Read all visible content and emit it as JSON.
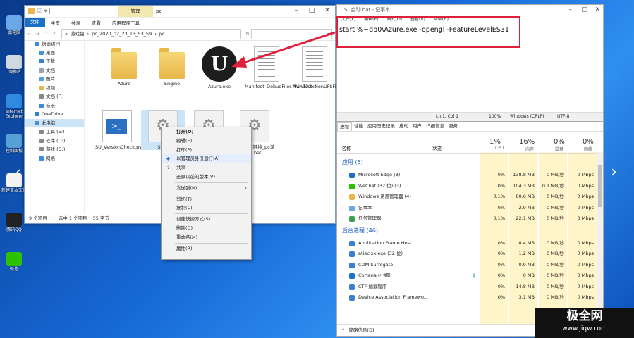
{
  "desktop": {
    "icons": [
      {
        "label": "此电脑",
        "icon": "computer-icon",
        "color": "#6aa8e8"
      },
      {
        "label": "回收站",
        "icon": "recycle-bin-icon",
        "color": "#d0d8e0"
      },
      {
        "label": "Internet Explorer",
        "icon": "ie-icon",
        "color": "#2f8ae0"
      },
      {
        "label": "控制面板",
        "icon": "control-panel-icon",
        "color": "#58a0d8"
      },
      {
        "label": "新建文本文档",
        "icon": "text-file-icon",
        "color": "#f4f4f4"
      },
      {
        "label": "腾讯QQ",
        "icon": "qq-icon",
        "color": "#222222"
      },
      {
        "label": "微信",
        "icon": "wechat-icon",
        "color": "#2dc100"
      }
    ]
  },
  "explorer": {
    "tab_manage": "管理",
    "title": "pc",
    "ribbon_tabs": [
      "文件",
      "主页",
      "共享",
      "查看",
      "应用程序工具"
    ],
    "address": {
      "parts": [
        "«",
        "游戏包",
        "›",
        "pc_2020_02_23_13_53_59",
        "›",
        "pc"
      ],
      "search_icon": "search-icon"
    },
    "nav_items": [
      {
        "label": "快速访问",
        "icon": "star-icon",
        "color": "#3b8de0"
      },
      {
        "label": "桌面",
        "icon": "desktop-icon",
        "color": "#4a90d9"
      },
      {
        "label": "下载",
        "icon": "download-icon",
        "color": "#3b7fd0"
      },
      {
        "label": "文档",
        "icon": "documents-icon",
        "color": "#9aa4b0"
      },
      {
        "label": "图片",
        "icon": "pictures-icon",
        "color": "#5aa0d8"
      },
      {
        "label": "视频",
        "icon": "folder-icon",
        "color": "#e8b64a"
      },
      {
        "label": "文档 (F:)",
        "icon": "drive-icon",
        "color": "#888888"
      },
      {
        "label": "音乐",
        "icon": "music-icon",
        "color": "#3b8de0"
      },
      {
        "label": "OneDrive",
        "icon": "onedrive-icon",
        "color": "#2f7fd0"
      },
      {
        "label": "此电脑",
        "icon": "computer-icon",
        "color": "#4a90d9"
      },
      {
        "label": "工具 (E:)",
        "icon": "drive-icon",
        "color": "#888888"
      },
      {
        "label": "软件 (D:)",
        "icon": "drive-icon",
        "color": "#888888"
      },
      {
        "label": "游戏 (G:)",
        "icon": "drive-icon",
        "color": "#888888"
      },
      {
        "label": "网络",
        "icon": "network-icon",
        "color": "#3b8de0"
      }
    ],
    "files": [
      {
        "name": "Azure",
        "kind": "folder"
      },
      {
        "name": "Engine",
        "kind": "folder"
      },
      {
        "name": "Azure.exe",
        "kind": "ue"
      },
      {
        "name": "Manifest_DebugFiles_Win32.txt",
        "kind": "doc"
      },
      {
        "name": "Manifest_NonUFSFiles_Win32.txt",
        "kind": "doc"
      },
      {
        "name": "SU_VersionCheck.ps1",
        "kind": "ps"
      },
      {
        "name": "SU启",
        "kind": "gear"
      },
      {
        "name": "",
        "kind": "gear"
      },
      {
        "name": "删除快速链接_pc游戏.bat",
        "kind": "gear"
      }
    ],
    "status": {
      "count": "9 个项目",
      "selected": "选中 1 个项目",
      "size": "55 字节"
    }
  },
  "context_menu": {
    "items": [
      {
        "label": "打开(O)",
        "bold": true
      },
      {
        "label": "编辑(E)"
      },
      {
        "label": "打印(P)"
      },
      {
        "label": "以管理员身份运行(A)",
        "highlight": true,
        "icon": "shield-icon"
      },
      {
        "label": "共享",
        "icon": "share-icon"
      },
      {
        "label": "还原以前的版本(V)"
      },
      {
        "sep": true
      },
      {
        "label": "发送到(N)",
        "arrow": "›"
      },
      {
        "sep": true
      },
      {
        "label": "剪切(T)"
      },
      {
        "label": "复制(C)"
      },
      {
        "sep": true
      },
      {
        "label": "创建快捷方式(S)"
      },
      {
        "label": "删除(D)"
      },
      {
        "label": "重命名(M)"
      },
      {
        "sep": true
      },
      {
        "label": "属性(R)"
      }
    ]
  },
  "notepad": {
    "title": "SU启动.bat - 记事本",
    "menu": [
      "文件(F)",
      "编辑(E)",
      "格式(O)",
      "查看(V)",
      "帮助(H)"
    ],
    "content": "start %~dp0\\Azure.exe -opengl -FeatureLevelES31",
    "status": {
      "position": "Ln 1, Col 1",
      "zoom": "100%",
      "eol": "Windows (CRLF)",
      "encoding": "UTF-8"
    }
  },
  "taskmgr": {
    "tabs": [
      "进程",
      "性能",
      "应用历史记录",
      "启动",
      "用户",
      "详细信息",
      "服务"
    ],
    "columns": {
      "name": "名称",
      "status": "状态",
      "cpu": {
        "pct": "1%",
        "label": "CPU"
      },
      "mem": {
        "pct": "16%",
        "label": "内存"
      },
      "disk": {
        "pct": "0%",
        "label": "磁盘"
      },
      "net": {
        "pct": "0%",
        "label": "网络"
      }
    },
    "groups": {
      "apps": "应用 (5)",
      "background": "后台进程 (46)"
    },
    "apps": [
      {
        "name": "Microsoft Edge (8)",
        "cpu": "0%",
        "mem": "138.8 MB",
        "disk": "0 MB/秒",
        "net": "0 Mbps",
        "color": "#1e6fd0"
      },
      {
        "name": "WeChat (32 位) (3)",
        "cpu": "0%",
        "mem": "104.3 MB",
        "disk": "0.1 MB/秒",
        "net": "0 Mbps",
        "color": "#2dc100"
      },
      {
        "name": "Windows 资源管理器 (4)",
        "cpu": "0.1%",
        "mem": "80.6 MB",
        "disk": "0 MB/秒",
        "net": "0 Mbps",
        "color": "#e8b64a"
      },
      {
        "name": "记事本",
        "cpu": "0%",
        "mem": "2.9 MB",
        "disk": "0 MB/秒",
        "net": "0 Mbps",
        "color": "#6aa8e8"
      },
      {
        "name": "任务管理器",
        "cpu": "0.1%",
        "mem": "22.1 MB",
        "disk": "0 MB/秒",
        "net": "0 Mbps",
        "color": "#3aa050"
      }
    ],
    "background": [
      {
        "name": "Application Frame Host",
        "cpu": "0%",
        "mem": "8.4 MB",
        "disk": "0 MB/秒",
        "net": "0 Mbps",
        "color": "#3b7fd0"
      },
      {
        "name": "atieclxx.exe (32 位)",
        "cpu": "0%",
        "mem": "1.2 MB",
        "disk": "0 MB/秒",
        "net": "0 Mbps",
        "color": "#3b7fd0"
      },
      {
        "name": "COM Surrogate",
        "cpu": "0%",
        "mem": "0.9 MB",
        "disk": "0 MB/秒",
        "net": "0 Mbps",
        "color": "#3b7fd0"
      },
      {
        "name": "Cortana (小娜)",
        "cpu": "0%",
        "mem": "0 MB",
        "disk": "0 MB/秒",
        "net": "0 Mbps",
        "color": "#1e6fd0"
      },
      {
        "name": "CTF 加载程序",
        "cpu": "0%",
        "mem": "14.8 MB",
        "disk": "0 MB/秒",
        "net": "0 Mbps",
        "color": "#3b7fd0"
      },
      {
        "name": "Device Association Framewo...",
        "cpu": "0%",
        "mem": "3.1 MB",
        "disk": "0 MB/秒",
        "net": "0 Mbps",
        "color": "#3b7fd0"
      }
    ],
    "footer": "简略信息(D)"
  },
  "watermark": {
    "name": "极全网",
    "url": "www.jiqw.com"
  }
}
